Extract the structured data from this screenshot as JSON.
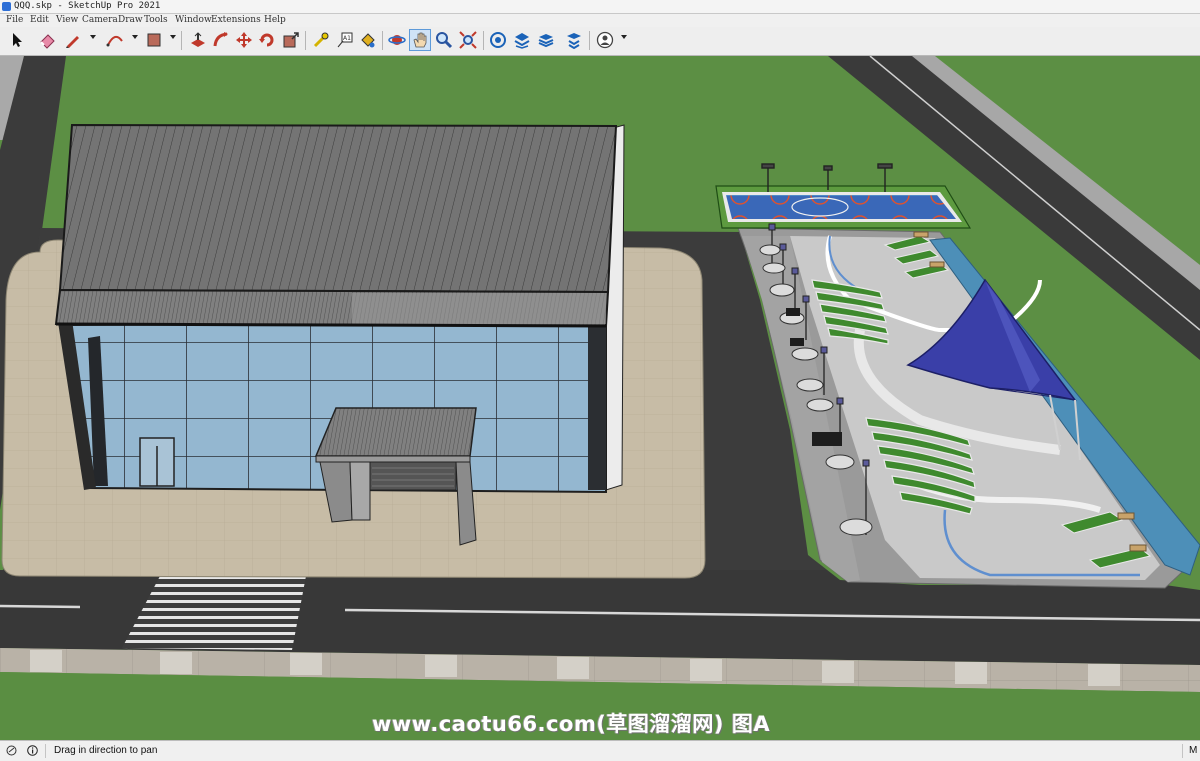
{
  "window": {
    "title": "QQQ.skp - SketchUp Pro 2021"
  },
  "menu": {
    "items": [
      "File",
      "Edit",
      "View",
      "Camera",
      "Draw",
      "Tools",
      "Window",
      "Extensions",
      "Help"
    ]
  },
  "toolbar": {
    "tools": [
      {
        "name": "select-tool",
        "icon": "arrow-cursor-icon"
      },
      {
        "name": "eraser-tool",
        "icon": "eraser-icon"
      },
      {
        "name": "line-tool",
        "icon": "pencil-icon",
        "dropdown": true
      },
      {
        "name": "arc-tool",
        "icon": "arc-icon",
        "dropdown": true
      },
      {
        "name": "shape-tool",
        "icon": "rectangle-icon",
        "dropdown": true
      },
      {
        "name": "push-pull-tool",
        "icon": "push-pull-icon"
      },
      {
        "name": "follow-me-tool",
        "icon": "follow-me-icon"
      },
      {
        "name": "move-tool",
        "icon": "move-icon"
      },
      {
        "name": "rotate-tool",
        "icon": "rotate-icon"
      },
      {
        "name": "scale-tool",
        "icon": "scale-icon"
      },
      {
        "name": "tape-measure-tool",
        "icon": "tape-measure-icon"
      },
      {
        "name": "text-tool",
        "icon": "text-icon"
      },
      {
        "name": "paint-bucket-tool",
        "icon": "paint-bucket-icon"
      },
      {
        "name": "orbit-tool",
        "icon": "orbit-icon"
      },
      {
        "name": "pan-tool",
        "icon": "pan-hand-icon",
        "active": true
      },
      {
        "name": "zoom-tool",
        "icon": "magnifier-icon"
      },
      {
        "name": "zoom-extents-tool",
        "icon": "zoom-extents-icon"
      },
      {
        "name": "3d-warehouse-button",
        "icon": "warehouse-icon"
      },
      {
        "name": "extension-warehouse-button",
        "icon": "extension-warehouse-icon"
      },
      {
        "name": "layout-button",
        "icon": "layers-icon"
      },
      {
        "name": "extension-manager-button",
        "icon": "extension-manager-icon"
      },
      {
        "name": "account-button",
        "icon": "user-account-icon",
        "dropdown": true
      }
    ]
  },
  "viewport": {
    "watermark": "www.caotu66.com(草图溜溜网) 图A"
  },
  "status": {
    "message": "Drag in direction to pan",
    "measurements_label": "M",
    "icons": [
      "geo-location-icon",
      "info-icon"
    ]
  },
  "colors": {
    "grass": "#5e8f45",
    "road": "#3b3b3b",
    "paving": "#c8bba3",
    "glass": "#8fb4cf",
    "roof": "#707070",
    "canopy": "#3a3fa8",
    "water": "#4d8fb8",
    "active_tool": "#cfe3f7"
  }
}
